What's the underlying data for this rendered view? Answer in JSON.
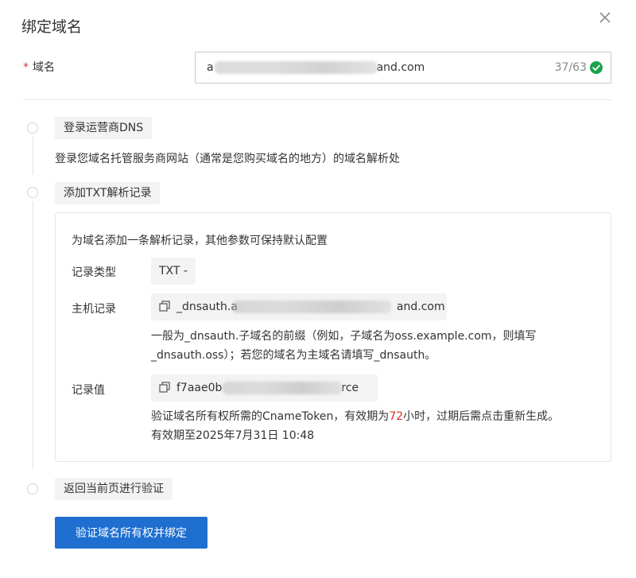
{
  "dialog": {
    "title": "绑定域名",
    "close_icon": "close-icon"
  },
  "domain_field": {
    "required_mark": "*",
    "label": "域名",
    "value_prefix": "a",
    "value_suffix": "and.com",
    "char_count": "37/63",
    "valid_icon": "check-circle-icon",
    "valid_color": "#1aa34a"
  },
  "steps": [
    {
      "title": "登录运营商DNS",
      "desc": "登录您域名托管服务商网站（通常是您购买域名的地方）的域名解析处"
    },
    {
      "title": "添加TXT解析记录"
    },
    {
      "title": "返回当前页进行验证"
    }
  ],
  "record": {
    "intro": "为域名添加一条解析记录，其他参数可保持默认配置",
    "type_label": "记录类型",
    "type_value": "TXT -",
    "host_label": "主机记录",
    "host_prefix": "_dnsauth.a",
    "host_suffix": "and.com",
    "host_hint_line1": "一般为_dnsauth.子域名的前缀（例如，子域名为oss.example.com，则填写",
    "host_hint_line2": "_dnsauth.oss）；若您的域名为主域名请填写_dnsauth。",
    "value_label": "记录值",
    "value_prefix": "f7aae0b",
    "value_suffix": "rce",
    "value_hint_before": "验证域名所有权所需的CnameToken，有效期为",
    "value_hint_hours": "72",
    "value_hint_after": "小时，过期后需点击重新生成。",
    "expiry": "有效期至2025年7月31日 10:48",
    "copy_icon": "copy-icon"
  },
  "submit_label": "验证域名所有权并绑定",
  "colors": {
    "primary": "#1f6fd1",
    "danger": "#d93026",
    "success": "#1aa34a"
  }
}
